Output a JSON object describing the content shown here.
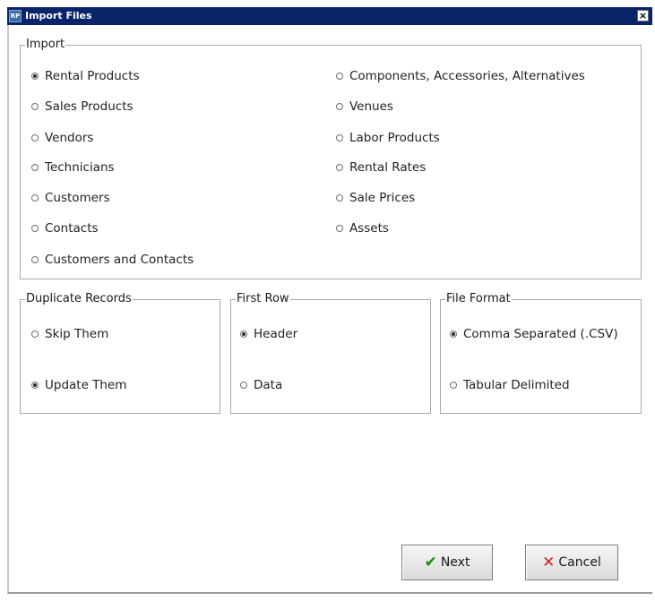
{
  "window": {
    "title": "Import Files",
    "app_icon_text": "RP",
    "close_symbol": "×"
  },
  "import_group": {
    "legend": "Import",
    "options": [
      {
        "label": "Rental Products",
        "checked": true
      },
      {
        "label": "Sales Products",
        "checked": false
      },
      {
        "label": "Vendors",
        "checked": false
      },
      {
        "label": "Technicians",
        "checked": false
      },
      {
        "label": "Customers",
        "checked": false
      },
      {
        "label": "Contacts",
        "checked": false
      },
      {
        "label": "Customers and Contacts",
        "checked": false
      },
      {
        "label": "Components, Accessories, Alternatives",
        "checked": false
      },
      {
        "label": "Venues",
        "checked": false
      },
      {
        "label": "Labor Products",
        "checked": false
      },
      {
        "label": "Rental Rates",
        "checked": false
      },
      {
        "label": "Sale Prices",
        "checked": false
      },
      {
        "label": "Assets",
        "checked": false
      }
    ]
  },
  "duplicate_group": {
    "legend": "Duplicate Records",
    "options": [
      {
        "label": "Skip Them",
        "checked": false
      },
      {
        "label": "Update Them",
        "checked": true
      }
    ]
  },
  "first_row_group": {
    "legend": "First Row",
    "options": [
      {
        "label": "Header",
        "checked": true
      },
      {
        "label": "Data",
        "checked": false
      }
    ]
  },
  "file_format_group": {
    "legend": "File Format",
    "options": [
      {
        "label": "Comma Separated (.CSV)",
        "checked": true
      },
      {
        "label": "Tabular Delimited",
        "checked": false
      }
    ]
  },
  "buttons": {
    "next_label": "Next",
    "next_icon": "✔",
    "cancel_label": "Cancel",
    "cancel_icon": "✕"
  },
  "colors": {
    "titlebar": "#0a246a",
    "next_icon": "#1a8a14",
    "cancel_icon": "#d42323"
  }
}
